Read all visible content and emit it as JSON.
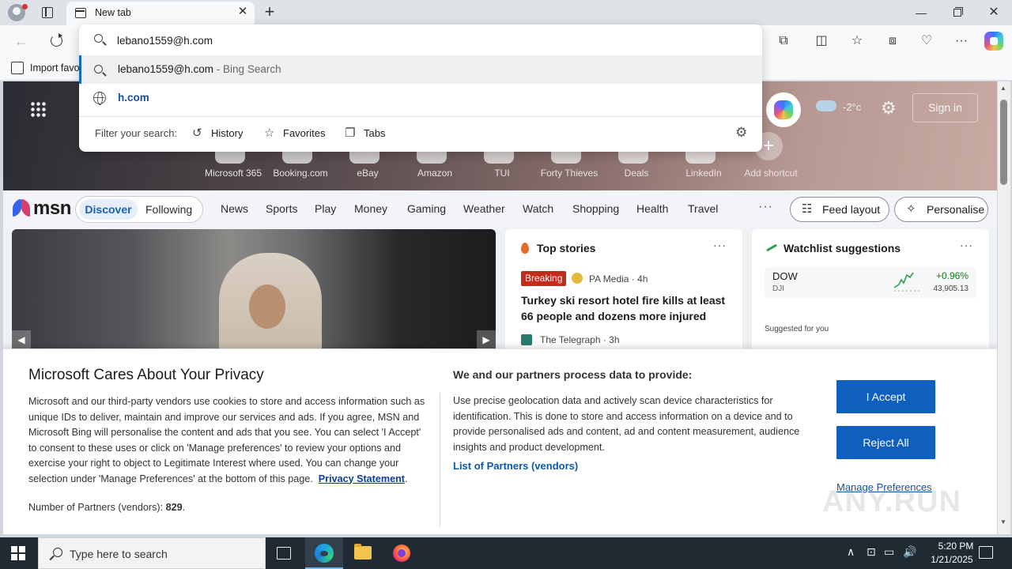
{
  "browser": {
    "tab_title": "New tab",
    "tab_close": "✕",
    "new_tab": "+",
    "window": {
      "minimize": "—",
      "maximize": "",
      "close": "✕"
    },
    "favorites_bar": {
      "import_label": "Import favo"
    }
  },
  "omnibox": {
    "query": "lebano1559@h.com",
    "suggestions": [
      {
        "text": "lebano1559@h.com",
        "suffix": " - Bing Search",
        "type": "search"
      },
      {
        "text": "h.com",
        "type": "site"
      }
    ],
    "filter_label": "Filter your search:",
    "filters": [
      {
        "label": "History",
        "icon": "history-icon"
      },
      {
        "label": "Favorites",
        "icon": "star-icon"
      },
      {
        "label": "Tabs",
        "icon": "tabs-icon"
      }
    ]
  },
  "msn": {
    "weather_temp": "-2°c",
    "sign_in": "Sign in",
    "shortcuts": [
      "Microsoft 365",
      "Booking.com",
      "eBay",
      "Amazon",
      "TUI",
      "Forty Thieves",
      "Deals",
      "LinkedIn",
      "Add shortcut"
    ],
    "logo": "msn",
    "nav": {
      "discover": "Discover",
      "following": "Following",
      "categories": [
        "News",
        "Sports",
        "Play",
        "Money",
        "Gaming",
        "Weather",
        "Watch",
        "Shopping",
        "Health",
        "Travel"
      ],
      "more": "···",
      "feed_layout": "Feed layout",
      "personalise": "Personalise"
    },
    "hero_prev": "◀",
    "hero_next": "▶",
    "top_stories": {
      "title": "Top stories",
      "more": "···",
      "badge": "Breaking",
      "source1": "PA Media · 4h",
      "headline": "Turkey ski resort hotel fire kills at least 66 people and dozens more injured",
      "source2": "The Telegraph · 3h"
    },
    "watchlist": {
      "title": "Watchlist suggestions",
      "more": "···",
      "stock": {
        "symbol": "DOW",
        "exchange": "DJI",
        "change": "+0.96%",
        "price": "43,905.13"
      },
      "suggested": "Suggested for you"
    }
  },
  "privacy": {
    "title": "Microsoft Cares About Your Privacy",
    "body": "Microsoft and our third-party vendors use cookies to store and access information such as unique IDs to deliver, maintain and improve our services and ads. If you agree, MSN and Microsoft Bing will personalise the content and ads that you see. You can select 'I Accept' to consent to these uses or click on 'Manage preferences' to review your options and exercise your right to object to Legitimate Interest where used.  You can change your selection under 'Manage Preferences' at the bottom of this page.",
    "privacy_link": "Privacy Statement",
    "partners_label": "Number of Partners (vendors):",
    "partners_count": "829",
    "subtitle": "We and our partners process data to provide:",
    "body2": "Use precise geolocation data and actively scan device characteristics for identification. This is done to store and access information on a device and to provide personalised ads and content, ad and content measurement, audience insights and product development.",
    "list_link": "List of Partners (vendors)",
    "accept": "I Accept",
    "reject": "Reject All",
    "manage": "Manage Preferences",
    "watermark": "ANY.RUN"
  },
  "taskbar": {
    "search_placeholder": "Type here to search",
    "time": "5:20 PM",
    "date": "1/21/2025"
  }
}
